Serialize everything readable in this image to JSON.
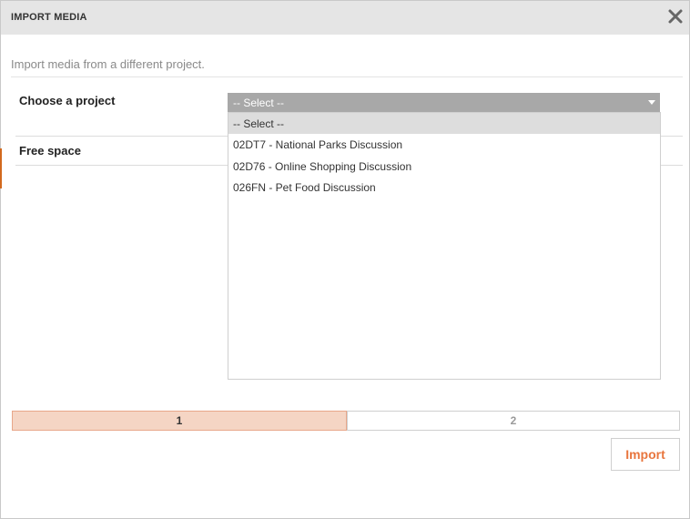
{
  "dialog": {
    "title": "IMPORT MEDIA",
    "subtitle": "Import media from a different project."
  },
  "form": {
    "choose_project_label": "Choose a project",
    "free_space_label": "Free space",
    "select_value": "-- Select --"
  },
  "dropdown": {
    "options": [
      "-- Select --",
      "02DT7 - National Parks Discussion",
      "02D76 - Online Shopping Discussion",
      "026FN - Pet Food Discussion"
    ],
    "selected_index": 0
  },
  "steps": [
    {
      "label": "1",
      "active": true
    },
    {
      "label": "2",
      "active": false
    }
  ],
  "buttons": {
    "import_label": "Import"
  },
  "colors": {
    "accent": "#e8763e",
    "header_bg": "#e5e5e5",
    "select_bg": "#a8a8a8",
    "active_step_bg": "#f5d5c4"
  },
  "icons": {
    "close": "close-icon",
    "dropdown_arrow": "chevron-down-icon"
  }
}
